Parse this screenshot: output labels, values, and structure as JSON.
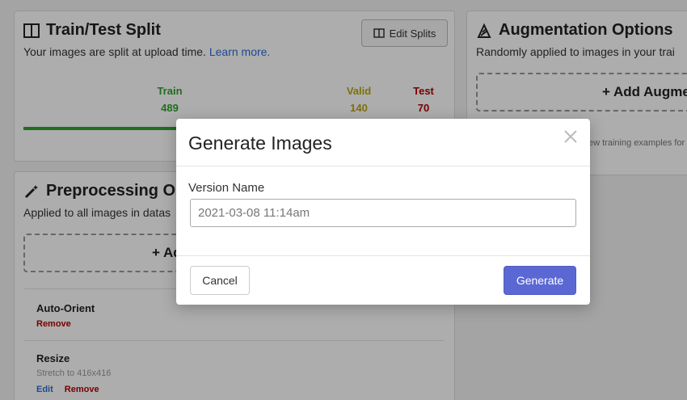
{
  "train_test_split": {
    "title": "Train/Test Split",
    "subtitle": "Your images are split at upload time.",
    "learn_more": "Learn more.",
    "edit_button": "Edit Splits",
    "splits": [
      {
        "label": "Train",
        "count": "489",
        "color": "#2ea32e"
      },
      {
        "label": "Valid",
        "count": "140",
        "color": "#b8a70c"
      },
      {
        "label": "Test",
        "count": "70",
        "color": "#b40000"
      }
    ]
  },
  "augmentation": {
    "title": "Augmentation Options",
    "subtitle": "Randomly applied to images in your trai",
    "add_button": "+ Add Augme",
    "note": "ew training examples for"
  },
  "preprocessing": {
    "title": "Preprocessing Optio",
    "subtitle": "Applied to all images in datas",
    "add_button": "+ Ad",
    "steps": [
      {
        "name": "Auto-Orient",
        "remove": "Remove"
      },
      {
        "name": "Resize",
        "desc": "Stretch to 416x416",
        "edit": "Edit",
        "remove": "Remove"
      }
    ]
  },
  "modal": {
    "title": "Generate Images",
    "version_label": "Version Name",
    "version_value": "2021-03-08 11:14am",
    "cancel": "Cancel",
    "generate": "Generate"
  }
}
